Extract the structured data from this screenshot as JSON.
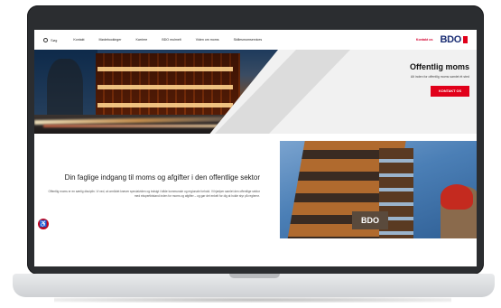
{
  "nav": {
    "search_label": "Søg",
    "links": [
      "Kontakt",
      "Mødebookinger",
      "Karriere",
      "BDO mulmelt",
      "Viden om moms",
      "Skillesmomservices"
    ],
    "cta": "Kontakt os",
    "logo": "BDO"
  },
  "hero": {
    "title": "Offentlig moms",
    "subtitle": "Alt inden for offentlig moms samlet ét sted",
    "button": "KONTAKT OS"
  },
  "content": {
    "heading": "Din faglige indgang til moms og afgifter i den offentlige sektor",
    "body": "Offentlig moms er en særlig disciplin. Vi ved, at området kræver specialviden og indsigt i både kommunale og regionale forhold. Vi hjælper samlet den offentlige sektor med ekspertbistand inden for moms og afgifter – og gør det enkelt for dig at holde styr på reglerne.",
    "sign": "BDO"
  },
  "colors": {
    "brand_red": "#e1001a",
    "brand_blue": "#1b2e74"
  },
  "icons": {
    "search": "search-icon",
    "accessibility": "accessibility-icon"
  }
}
